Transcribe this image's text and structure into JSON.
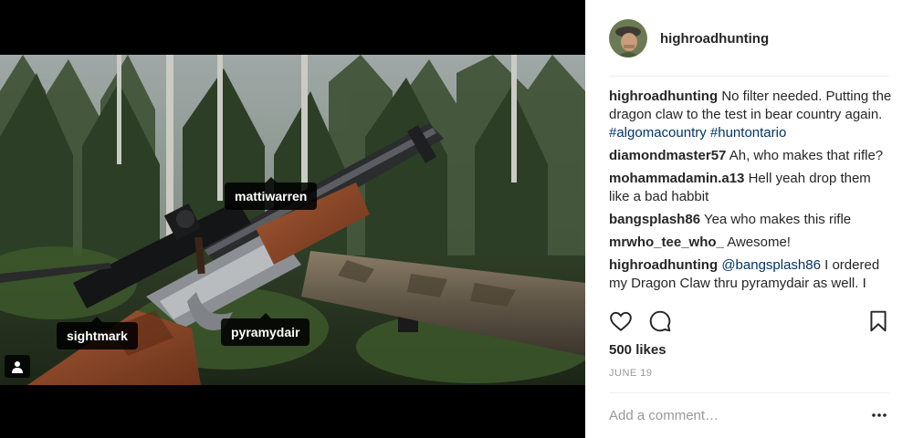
{
  "post": {
    "author": "highroadhunting",
    "photo_tags": {
      "mattiwarren": "mattiwarren",
      "sightmark": "sightmark",
      "pyramydair": "pyramydair"
    },
    "comments": [
      {
        "username": "highroadhunting",
        "parts": [
          {
            "text": "No filter needed. Putting the dragon claw to the test in bear country again. ",
            "link": false
          },
          {
            "text": "#algomacountry",
            "link": true
          },
          {
            "text": " ",
            "link": false
          },
          {
            "text": "#huntontario",
            "link": true
          }
        ]
      },
      {
        "username": "diamondmaster57",
        "parts": [
          {
            "text": "Ah, who makes that rifle?",
            "link": false
          }
        ]
      },
      {
        "username": "mohammadamin.a13",
        "parts": [
          {
            "text": "Hell yeah drop them like a bad habbit",
            "link": false
          }
        ]
      },
      {
        "username": "bangsplash86",
        "parts": [
          {
            "text": "Yea who makes this rifle",
            "link": false
          }
        ]
      },
      {
        "username": "mrwho_tee_who_",
        "parts": [
          {
            "text": "Awesome!",
            "link": false
          }
        ]
      },
      {
        "username": "highroadhunting",
        "parts": [
          {
            "text": "@bangsplash86",
            "link": true
          },
          {
            "text": " I ordered my Dragon Claw thru pyramydair as well. I",
            "link": false
          }
        ]
      }
    ],
    "likes": "500 likes",
    "date": "JUNE 19"
  },
  "add_comment": {
    "placeholder": "Add a comment…"
  },
  "icons": {
    "like": "heart-icon",
    "comment": "comment-bubble-icon",
    "save": "bookmark-icon",
    "more": "more-options-icon",
    "user_tags": "person-icon"
  },
  "colors": {
    "link": "#003569",
    "muted": "#999999",
    "text": "#262626",
    "divider": "#efefef"
  }
}
